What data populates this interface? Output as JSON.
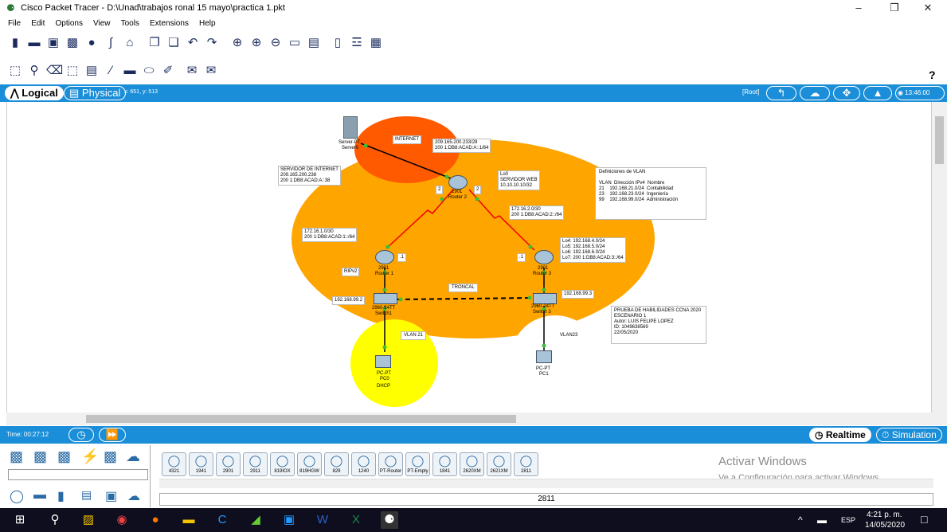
{
  "window": {
    "title": "Cisco Packet Tracer - D:\\Unad\\trabajos ronal 15 mayo\\practica 1.pkt",
    "minimize": "–",
    "maximize": "❐",
    "close": "✕"
  },
  "menu": [
    "File",
    "Edit",
    "Options",
    "View",
    "Tools",
    "Extensions",
    "Help"
  ],
  "help": "?",
  "modebar": {
    "logical": "Logical",
    "physical": "Physical",
    "coords": "x: 651, y: 513",
    "root": "[Root]",
    "clock": "13:46:00"
  },
  "topology": {
    "internet": "INTERNET",
    "server_type": "Server-PT",
    "server_name": "Server0",
    "server_note": "SERVIDOR DE INTERNET\n209.165.200.238\n200 1:DB8:ACAD:A::38",
    "r2_link": "209.165.200.233/29\n200 1:DB8:ACAD:A::1/64",
    "r2_model": "2901",
    "r2_name": "Router 2",
    "lo0": "Lo0\nSERVIDOR WEB\n10.10.10.10/32",
    "port2a": "2",
    "port2b": "2",
    "vlan_def": "Definiciones de VLAN\n\nVLAN  Dirección IPv4  Nombre\n21    192.168.21.0/24  Contabilidad\n23    192.168.23.0/24  Ingeniería\n99    192.168.99.0/24  Administración",
    "net_r1": "172.16.1.0/30\n200 1:DB8:ACAD:1::/64",
    "net_r3": "172.16.2.0/30\n200 1:DB8:ACAD:2::/64",
    "r1_model": "2901",
    "r1_name": "Router 1",
    "r1_port": ".1",
    "r3_model": "2901",
    "r3_name": "Router 3",
    "r3_port": ".1",
    "rip": "RIPv2",
    "loops": "Lo4: 192.168.4.0/24\nLo5: 192.168.5.0/24\nLo6: 192.168.6.0/24\nLo7: 200 1:DB8:ACAD:3::/64",
    "troncal": "TRONCAL",
    "sw1_ip": "192.168.99.2",
    "sw1_model": "2960-24TT",
    "sw1_name": "Switch1",
    "sw3_ip": "192.168.99.3",
    "sw3_model": "2960-24TT",
    "sw3_name": "Switch 3",
    "info": "PRUEBA DE HABILIDADES CCNA 2020\nESCENARIO 1\nAutor: LUIS FELIPE LOPEZ\nID: 1049638569\n22/05/2020",
    "vlan21": "VLAN 21",
    "vlan23": "VLAN23",
    "pc0_type": "PC-PT",
    "pc0_name": "PC0",
    "pc0_dhcp": "DHCP",
    "pc1_type": "PC-PT",
    "pc1_name": "PC1"
  },
  "timebar": {
    "time": "Time: 00:27:12",
    "realtime": "Realtime",
    "simulation": "Simulation"
  },
  "devices": [
    "4321",
    "1941",
    "2901",
    "2911",
    "819IOX",
    "819HGW",
    "829",
    "1240",
    "PT-Router",
    "PT-Empty",
    "1841",
    "2620XM",
    "2621XM",
    "2811"
  ],
  "selected_device": "2811",
  "activate": {
    "title": "Activar Windows",
    "sub": "Ve a Configuración para activar Windows."
  },
  "taskbar": {
    "lang": "ESP",
    "time": "4:21 p. m.",
    "date": "14/05/2020"
  }
}
